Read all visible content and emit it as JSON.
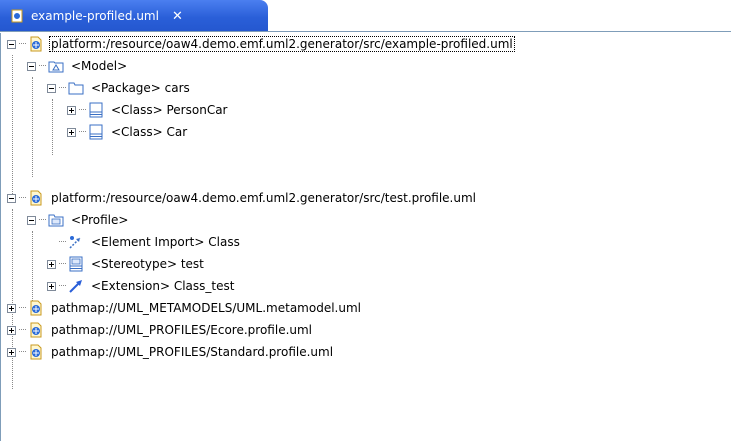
{
  "tab": {
    "title": "example-profiled.uml",
    "close": "✕"
  },
  "tree": {
    "r1": "platform:/resource/oaw4.demo.emf.uml2.generator/src/example-profiled.uml",
    "r2": "<Model>",
    "r3": "<Package> cars",
    "r4": "<Class> PersonCar",
    "r5": "<Class> Car",
    "r6": "platform:/resource/oaw4.demo.emf.uml2.generator/src/test.profile.uml",
    "r7": "<Profile>",
    "r8": "<Element Import> Class",
    "r9": "<Stereotype> test",
    "r10": "<Extension> Class_test",
    "r11": "pathmap://UML_METAMODELS/UML.metamodel.uml",
    "r12": "pathmap://UML_PROFILES/Ecore.profile.uml",
    "r13": "pathmap://UML_PROFILES/Standard.profile.uml"
  }
}
